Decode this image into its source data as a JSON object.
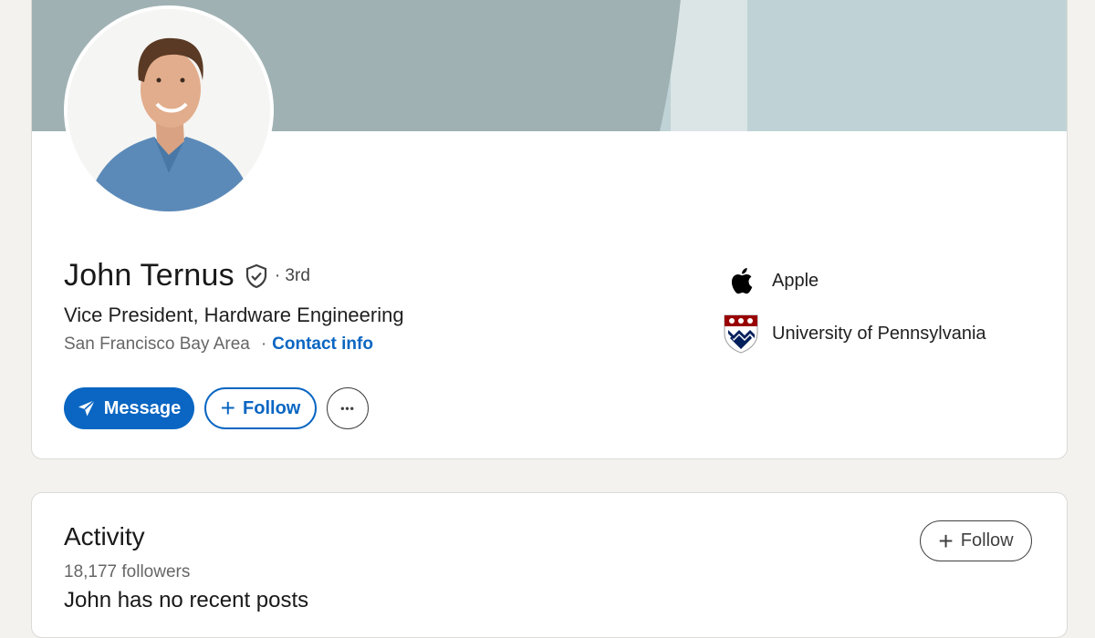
{
  "profile": {
    "name": "John Ternus",
    "degree": "· 3rd",
    "headline": "Vice President, Hardware Engineering",
    "location": "San Francisco Bay Area",
    "location_separator": "·",
    "contact_info": "Contact info",
    "verified_icon": "shield-check-icon"
  },
  "actions": {
    "message_label": "Message",
    "follow_label": "Follow",
    "follow_plus": "+",
    "more_label": "•••"
  },
  "affiliations": [
    {
      "name": "Apple",
      "icon": "apple-logo-icon"
    },
    {
      "name": "University of Pennsylvania",
      "icon": "penn-shield-icon"
    }
  ],
  "activity": {
    "title": "Activity",
    "followers": "18,177 followers",
    "no_posts": "John has no recent posts",
    "follow_label": "Follow",
    "follow_plus": "+"
  },
  "colors": {
    "accent": "#0a66c2",
    "banner_dark": "#9fb1b3",
    "banner_light": "#bfd3d6",
    "page_bg": "#f4f2ee"
  }
}
